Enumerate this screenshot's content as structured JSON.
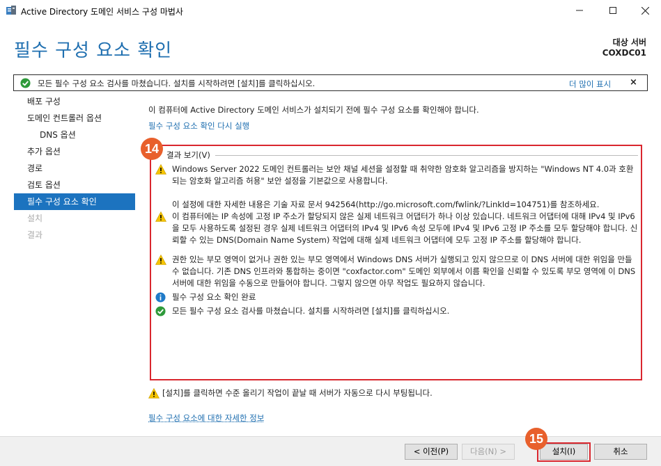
{
  "window": {
    "title": "Active Directory 도메인 서비스 구성 마법사",
    "minimize_glyph": "—",
    "close_glyph": "✕"
  },
  "header": {
    "page_title": "필수 구성 요소 확인",
    "target_label": "대상 서버",
    "target_name": "COXDC01"
  },
  "notice": {
    "message": "모든 필수 구성 요소 검사를 마쳤습니다. 설치를 시작하려면 [설치]를 클릭하십시오.",
    "more_link": "더 많이 표시",
    "close_glyph": "×"
  },
  "nav": {
    "items": [
      {
        "label": "배포 구성",
        "state": "normal"
      },
      {
        "label": "도메인 컨트롤러 옵션",
        "state": "normal"
      },
      {
        "label": "DNS 옵션",
        "state": "sub"
      },
      {
        "label": "추가 옵션",
        "state": "normal"
      },
      {
        "label": "경로",
        "state": "normal"
      },
      {
        "label": "검토 옵션",
        "state": "normal"
      },
      {
        "label": "필수 구성 요소 확인",
        "state": "active"
      },
      {
        "label": "설치",
        "state": "disabled"
      },
      {
        "label": "결과",
        "state": "disabled"
      }
    ]
  },
  "main": {
    "intro": "이 컴퓨터에 Active Directory 도메인 서비스가 설치되기 전에 필수 구성 요소를 확인해야 합니다.",
    "rerun_link": "필수 구성 요소 확인 다시 실행",
    "results_legend": "결과 보기(V)",
    "results": [
      {
        "type": "warning",
        "text": "Windows Server 2022 도메인 컨트롤러는 보안 채널 세션을 설정할 때 취약한 암호화 알고리즘을 방지하는 \"Windows NT 4.0과 호환되는 암호화 알고리즘 허용\" 보안 설정을 기본값으로 사용합니다.",
        "note": "이 설정에 대한 자세한 내용은 기술 자료 문서 942564(http://go.microsoft.com/fwlink/?LinkId=104751)를 참조하세요."
      },
      {
        "type": "warning",
        "text": "이 컴퓨터에는 IP 속성에 고정 IP 주소가 할당되지 않은 실제 네트워크 어댑터가 하나 이상 있습니다. 네트워크 어댑터에 대해 IPv4 및 IPv6을 모두 사용하도록 설정된 경우 실제 네트워크 어댑터의 IPv4 및 IPv6 속성 모두에 IPv4 및 IPv6 고정 IP 주소를 모두 할당해야 합니다. 신뢰할 수 있는 DNS(Domain Name System) 작업에 대해 실제 네트워크 어댑터에 모두 고정 IP 주소를 할당해야 합니다."
      },
      {
        "type": "warning",
        "text": "권한 있는 부모 영역이 없거나 권한 있는 부모 영역에서 Windows DNS 서버가 실행되고 있지 않으므로 이 DNS 서버에 대한 위임을 만들 수 없습니다. 기존 DNS 인프라와 통합하는 중이면 \"coxfactor.com\" 도메인 외부에서 이름 확인을 신뢰할 수 있도록 부모 영역에 이 DNS 서버에 대한 위임을 수동으로 만들어야 합니다. 그렇지 않으면 아무 작업도 필요하지 않습니다."
      },
      {
        "type": "info",
        "text": "필수 구성 요소 확인 완료"
      },
      {
        "type": "success",
        "text": "모든 필수 구성 요소 검사를 마쳤습니다. 설치를 시작하려면 [설치]를 클릭하십시오."
      }
    ],
    "reboot_warning": "[설치]를 클릭하면 수준 올리기 작업이 끝날 때 서버가 자동으로 다시 부팅됩니다.",
    "more_info_link": "필수 구성 요소에 대한 자세한 정보"
  },
  "footer": {
    "prev": "< 이전(P)",
    "next": "다음(N) >",
    "install": "설치(I)",
    "cancel": "취소"
  },
  "annotations": {
    "badge_results": "14",
    "badge_install": "15"
  },
  "colors": {
    "accent": "#1c73bf",
    "link": "#1f6fb0",
    "highlight": "#d9262e",
    "badge": "#e8602c",
    "warning": "#f5c400",
    "success": "#2e9a3a",
    "info": "#1f7ac8"
  }
}
